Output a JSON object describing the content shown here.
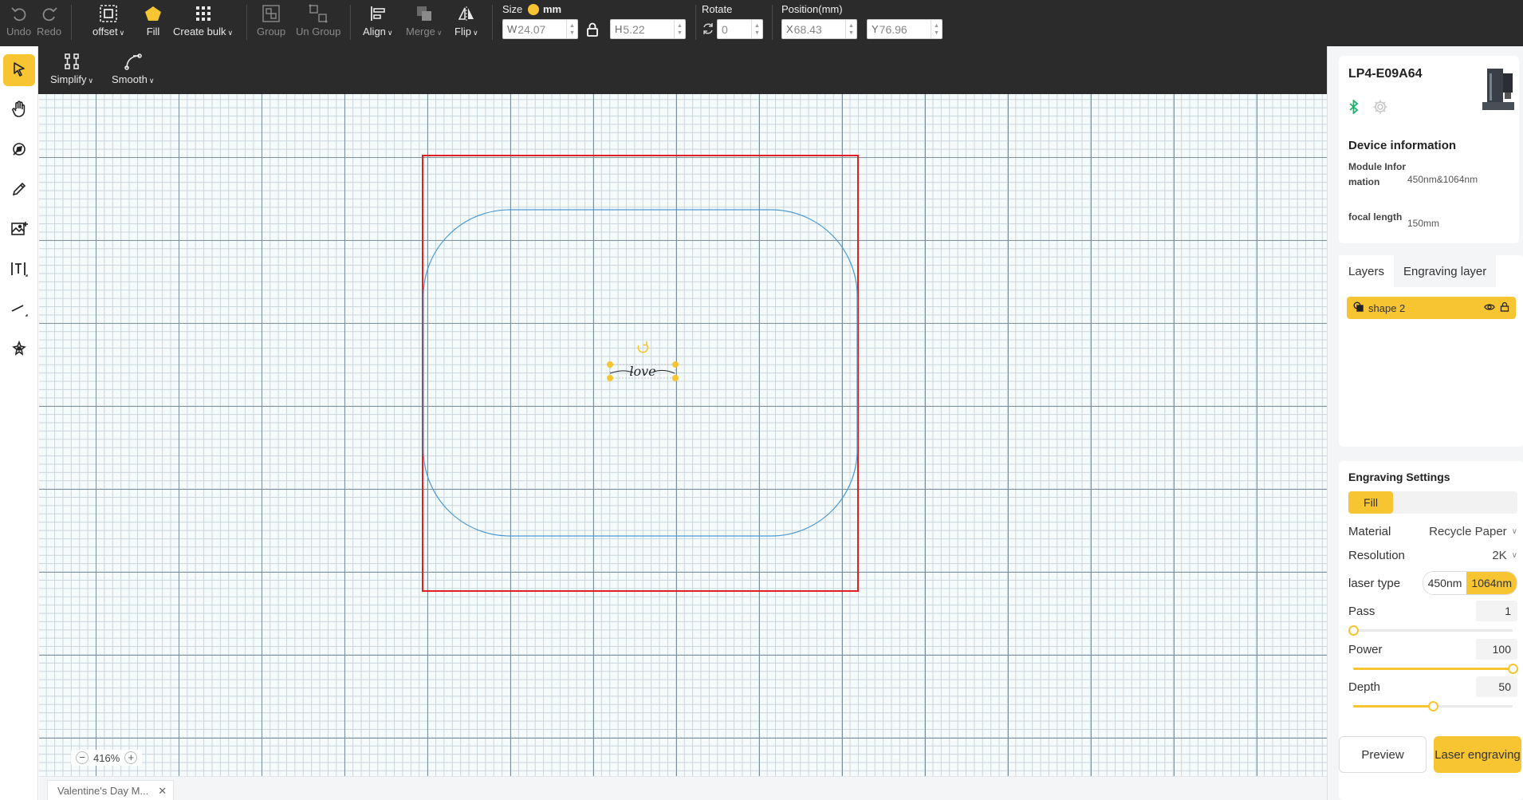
{
  "toolbar": {
    "undo": "Undo",
    "redo": "Redo",
    "offset": "offset",
    "fill": "Fill",
    "create_bulk": "Create bulk",
    "group": "Group",
    "ungroup": "Un Group",
    "align": "Align",
    "merge": "Merge",
    "flip": "Flip",
    "size_label": "Size",
    "size_unit": "mm",
    "width_prefix": "W",
    "width_value": "24.07",
    "height_prefix": "H",
    "height_value": "5.22",
    "rotate_label": "Rotate",
    "rotate_value": "0",
    "position_label": "Position(mm)",
    "x_prefix": "X",
    "x_value": "68.43",
    "y_prefix": "Y",
    "y_value": "76.96"
  },
  "subtoolbar": {
    "simplify": "Simplify",
    "smooth": "Smooth"
  },
  "canvas": {
    "text_object": "love",
    "zoom": "416%"
  },
  "tabs": {
    "doc_tab": "Valentine's Day M..."
  },
  "device": {
    "name": "LP4-E09A64",
    "info_title": "Device information",
    "module_label": "Module Information",
    "module_value": "450nm&1064nm",
    "focal_label": "focal length",
    "focal_value": "150mm"
  },
  "layers": {
    "tab_layers": "Layers",
    "tab_engraving": "Engraving layer",
    "items": [
      {
        "name": "shape 2"
      }
    ]
  },
  "engraving": {
    "title": "Engraving Settings",
    "mode": "Fill",
    "material_label": "Material",
    "material_value": "Recycle Paper",
    "resolution_label": "Resolution",
    "resolution_value": "2K",
    "laser_type_label": "laser type",
    "laser_options": [
      "450nm",
      "1064nm"
    ],
    "laser_selected": "1064nm",
    "pass_label": "Pass",
    "pass_value": "1",
    "pass_fraction": 0,
    "power_label": "Power",
    "power_value": "100",
    "power_fraction": 1,
    "depth_label": "Depth",
    "depth_value": "50",
    "depth_fraction": 0.5,
    "preview": "Preview",
    "laser_engraving": "Laser engraving"
  },
  "colors": {
    "accent": "#f7c531",
    "toolbar_bg": "#2b2b2b",
    "boundary": "#e02020",
    "shape_outline": "#4a9ad4",
    "bluetooth": "#1db36a"
  }
}
